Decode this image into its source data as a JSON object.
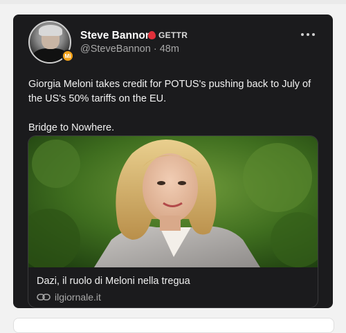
{
  "post": {
    "author_name": "Steve Bannon",
    "platform_badge": "GETTR",
    "handle": "@SteveBannon",
    "separator": "·",
    "time": "48m",
    "avatar_badge": "Mi",
    "body_paragraphs": [
      "Giorgia Meloni takes credit for POTUS's pushing back to July of the US's 50% tariffs on the EU.",
      "Bridge to Nowhere."
    ]
  },
  "link_preview": {
    "title": "Dazi, il ruolo di Meloni nella tregua",
    "domain": "ilgiornale.it"
  },
  "icons": {
    "more": "more-horizontal-icon",
    "link": "link-icon",
    "gettr": "gettr-logo-icon",
    "verified": "verified-badge-icon"
  },
  "colors": {
    "card_bg": "#1b1b1d",
    "page_bg": "#f2f2f2",
    "gettr_red": "#e0303a",
    "badge_orange": "#f3a21a"
  }
}
